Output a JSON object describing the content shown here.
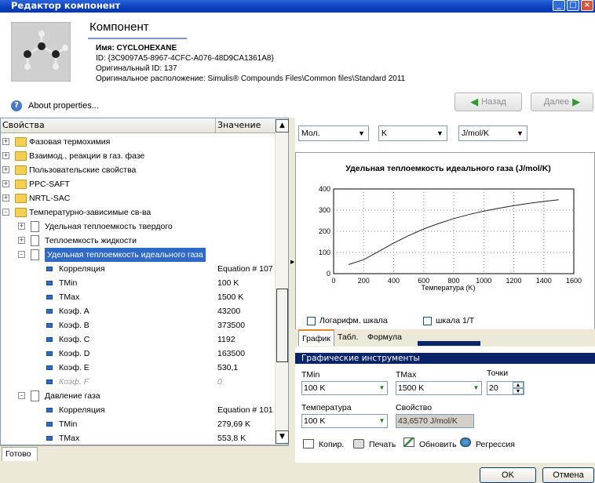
{
  "window": {
    "title": "Редактор компонент"
  },
  "header": {
    "title": "Компонент",
    "name_line": "Имя: CYCLOHEXANE",
    "id_line": "ID: {3C9097A5-8967-4CFC-A076-48D9CA1361A8}",
    "orig_id_line": "Оригинальный ID: 137",
    "orig_loc_line": "Оригинальное расположение: Simulis® Compounds Files\\Common files\\Standard 2011",
    "about": "About properties...",
    "back_label": "Назад",
    "next_label": "Далее"
  },
  "tree": {
    "col_props": "Свойства",
    "col_value": "Значение",
    "rows": [
      {
        "label": "Фазовая термохимия",
        "value": ""
      },
      {
        "label": "Взаимод., реакции в газ. фазе",
        "value": ""
      },
      {
        "label": "Пользовательские свойства",
        "value": ""
      },
      {
        "label": "PPC-SAFT",
        "value": ""
      },
      {
        "label": "NRTL-SAC",
        "value": ""
      },
      {
        "label": "Температурно-зависимые св-ва",
        "value": ""
      },
      {
        "label": "Удельная теплоемкость твердого",
        "value": ""
      },
      {
        "label": "Теплоемкость жидкости",
        "value": ""
      },
      {
        "label": "Удельная теплоемкость идеального газа",
        "value": ""
      },
      {
        "label": "Корреляция",
        "value": "Equation # 107"
      },
      {
        "label": "TMin",
        "value": "100 K"
      },
      {
        "label": "TMax",
        "value": "1500 K"
      },
      {
        "label": "Коэф. A",
        "value": "43200"
      },
      {
        "label": "Коэф. B",
        "value": "373500"
      },
      {
        "label": "Коэф. C",
        "value": "1192"
      },
      {
        "label": "Коэф. D",
        "value": "163500"
      },
      {
        "label": "Коэф. E",
        "value": "530,1"
      },
      {
        "label": "Коэф. F",
        "value": "0"
      },
      {
        "label": "Давление газа",
        "value": ""
      },
      {
        "label": "Корреляция",
        "value": "Equation # 101"
      },
      {
        "label": "TMin",
        "value": "279,69 K"
      },
      {
        "label": "TMax",
        "value": "553,8 K"
      }
    ]
  },
  "status": "Готово",
  "units": {
    "basis": "Мол.",
    "temp": "K",
    "cp": "J/mol/K"
  },
  "chart_data": {
    "type": "line",
    "title": "Удельная теплоемкость идеального газа (J/mol/K)",
    "xlabel": "Температура (K)",
    "ylabel": "",
    "xlim": [
      0,
      1600
    ],
    "ylim": [
      0,
      400
    ],
    "xticks": [
      0,
      200,
      400,
      600,
      800,
      1000,
      1200,
      1400,
      1600
    ],
    "yticks": [
      0,
      100,
      200,
      300,
      400
    ],
    "grid": true,
    "x": [
      100,
      200,
      300,
      400,
      500,
      600,
      700,
      800,
      900,
      1000,
      1100,
      1200,
      1300,
      1400,
      1500
    ],
    "y": [
      43,
      66,
      105,
      144,
      180,
      211,
      237,
      260,
      279,
      295,
      309,
      321,
      332,
      341,
      349
    ]
  },
  "checks": {
    "log": "Логарифм. шкала",
    "inv": "шкала 1/T"
  },
  "tabs": [
    "График",
    "Табл.",
    "Формула"
  ],
  "tools": {
    "header": "Графические инструменты",
    "tmin_label": "TMin",
    "tmin_value": "100 K",
    "tmax_label": "TMax",
    "tmax_value": "1500 K",
    "points_label": "Точки",
    "points_value": "20",
    "temp_label": "Температура",
    "temp_value": "100 K",
    "prop_label": "Свойство",
    "prop_value": "43,6570 J/mol/K",
    "copy": "Копир.",
    "print": "Печать",
    "refresh": "Обновить",
    "regress": "Регрессия"
  },
  "dialog": {
    "ok": "OK",
    "cancel": "Отмена"
  }
}
